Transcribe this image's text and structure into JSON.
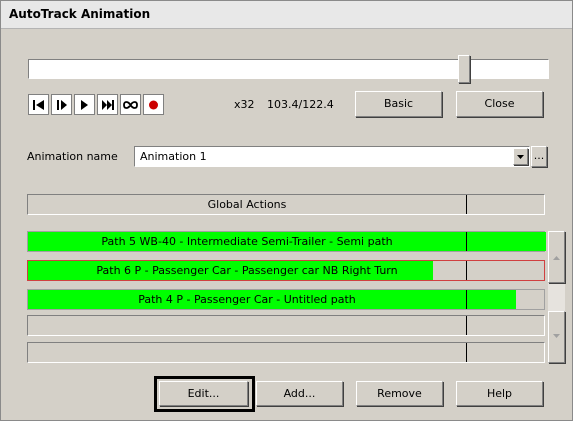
{
  "window": {
    "title": "AutoTrack Animation"
  },
  "transport": {
    "speed": "x32",
    "time_readout": "103.4/122.4",
    "basic_label": "Basic",
    "close_label": "Close"
  },
  "animation": {
    "name_label": "Animation name",
    "name_value": "Animation 1",
    "browse_label": "..."
  },
  "global_actions": {
    "label": "Global Actions"
  },
  "paths": [
    {
      "label": "Path 5 WB-40 - Intermediate Semi-Trailer - Semi path",
      "color": "#00ff00",
      "selected": false
    },
    {
      "label": "Path 6 P - Passenger Car - Passenger car NB Right Turn",
      "color": "#00ff00",
      "selected": true
    },
    {
      "label": "Path 4 P - Passenger Car - Untitled path",
      "color": "#00ff00",
      "selected": false
    }
  ],
  "buttons": {
    "edit": "Edit...",
    "add": "Add...",
    "remove": "Remove",
    "help": "Help"
  },
  "colors": {
    "progress_green": "#00ff00",
    "record_red": "#cc0000",
    "selection_border": "#d04040"
  }
}
